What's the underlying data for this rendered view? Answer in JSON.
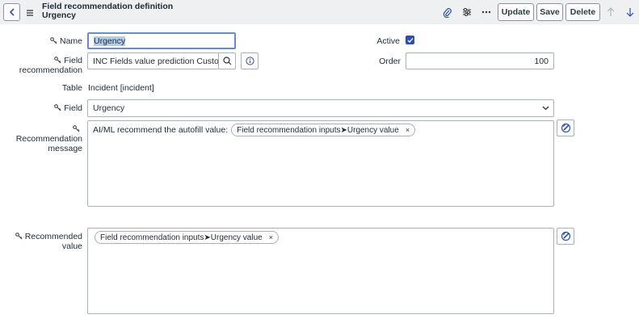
{
  "header": {
    "title_line1": "Field recommendation definition",
    "title_line2": "Urgency",
    "update_label": "Update",
    "save_label": "Save",
    "delete_label": "Delete"
  },
  "form": {
    "name_label": "Name",
    "name_value": "Urgency",
    "active_label": "Active",
    "active_checked": true,
    "field_rec_label_1": "Field",
    "field_rec_label_2": "recommendation",
    "field_rec_value": "INC Fields value prediction CustomM",
    "order_label": "Order",
    "order_value": "100",
    "table_label": "Table",
    "table_value": "Incident [incident]",
    "field_label": "Field",
    "field_value": "Urgency",
    "rec_msg_label_1": "Recommendation",
    "rec_msg_label_2": "message",
    "rec_msg_text": "AI/ML recommend the autofill value:",
    "rec_msg_pill": "Field recommendation inputs➤Urgency value",
    "rec_value_label_1": "Recommended",
    "rec_value_label_2": "value",
    "rec_value_pill": "Field recommendation inputs➤Urgency value",
    "pill_remove": "×"
  },
  "colors": {
    "header_bg": "#eef0f2",
    "accent": "#2f4fa8",
    "focus_border": "#6c8cc7"
  }
}
